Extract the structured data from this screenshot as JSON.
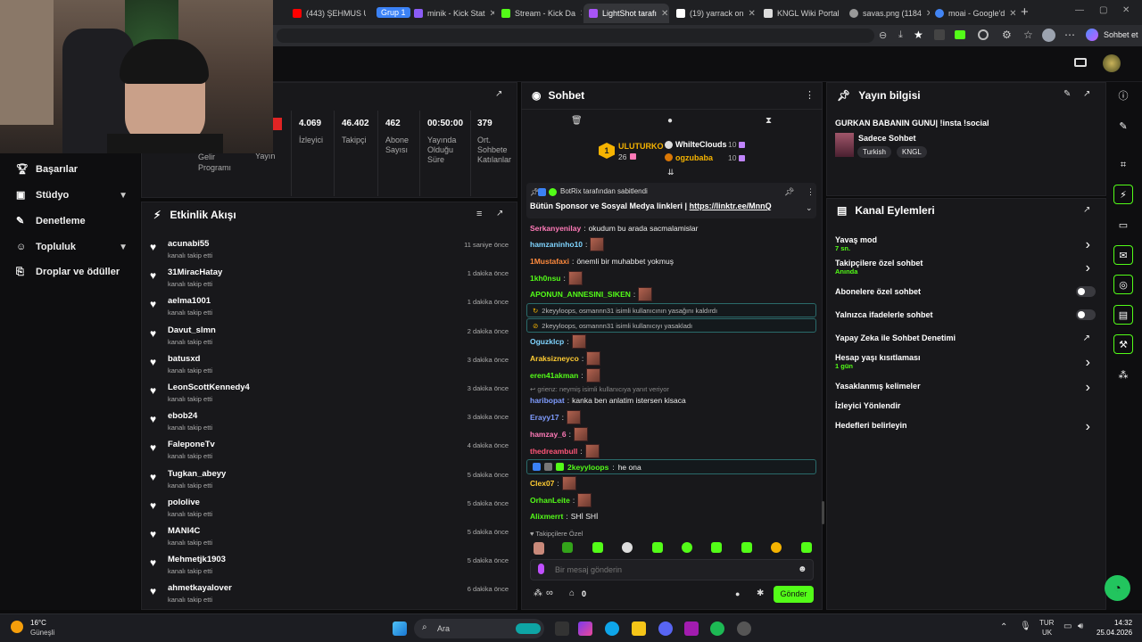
{
  "browser": {
    "tabs": [
      {
        "label": "(443) ŞEHMUS U",
        "color": "#ff0000"
      },
      {
        "label": "minik - Kick Stat",
        "color": "#8b5cf6"
      },
      {
        "label": "Stream - Kick Da",
        "color": "#53fc18"
      },
      {
        "label": "LightShot tarafı",
        "color": "#a855f7"
      },
      {
        "label": "(19) yarrack on",
        "color": "#ffffff"
      },
      {
        "label": "KNGL Wiki Portal",
        "color": "#dddddd"
      },
      {
        "label": "savas.png (1184",
        "color": "#999999"
      },
      {
        "label": "moai - Google'd",
        "color": "#4285f4"
      }
    ],
    "group_label": "Grup 1",
    "new_tab": "+",
    "sohbet_et": "Sohbet et"
  },
  "sidebar": {
    "items": [
      {
        "label": "Başarılar",
        "icon": "trophy-icon"
      },
      {
        "label": "Stüdyo",
        "icon": "studio-icon"
      },
      {
        "label": "Denetleme",
        "icon": "wrench-icon"
      },
      {
        "label": "Topluluk",
        "icon": "community-icon"
      },
      {
        "label": "Droplar ve ödüller",
        "icon": "drops-icon"
      }
    ]
  },
  "stats": {
    "partial": [
      {
        "label": "Gelir Programı"
      },
      {
        "label": "Yayın"
      }
    ],
    "items": [
      {
        "value": "4.069",
        "label": "İzleyici"
      },
      {
        "value": "46.402",
        "label": "Takipçi"
      },
      {
        "value": "462",
        "label": "Abone Sayısı"
      },
      {
        "value": "00:50:00",
        "label": "Yayında Olduğu Süre"
      },
      {
        "value": "379",
        "label": "Ort. Sohbete Katılanlar"
      }
    ]
  },
  "activity": {
    "title": "Etkinlik Akışı",
    "subtitle": "kanalı takip etti",
    "rows": [
      {
        "user": "acunabi55",
        "time": "11 saniye önce"
      },
      {
        "user": "31MiracHatay",
        "time": "1 dakika önce"
      },
      {
        "user": "aelma1001",
        "time": "1 dakika önce"
      },
      {
        "user": "Davut_slmn",
        "time": "2 dakika önce"
      },
      {
        "user": "batusxd",
        "time": "3 dakika önce"
      },
      {
        "user": "LeonScottKennedy4",
        "time": "3 dakika önce"
      },
      {
        "user": "ebob24",
        "time": "3 dakika önce"
      },
      {
        "user": "FaleponeTv",
        "time": "4 dakika önce"
      },
      {
        "user": "Tugkan_abeyy",
        "time": "5 dakika önce"
      },
      {
        "user": "pololive",
        "time": "5 dakika önce"
      },
      {
        "user": "MANI4C",
        "time": "5 dakika önce"
      },
      {
        "user": "Mehmetjk1903",
        "time": "5 dakika önce"
      },
      {
        "user": "ahmetkayalover",
        "time": "6 dakika önce"
      }
    ]
  },
  "chat": {
    "title": "Sohbet",
    "top_gifters": [
      {
        "name": "ULUTURKO",
        "count": "26",
        "rank": "1"
      },
      {
        "name": "WhiIteClouds",
        "count": "10"
      },
      {
        "name": "ogzubaba",
        "count": "10"
      }
    ],
    "pinned_by": "BotRix tarafından sabitlendi",
    "pinned_text": "Bütün Sponsor ve Sosyal Medya linkleri |",
    "pinned_link": "https://linktr.ee/MnnQ",
    "messages": [
      {
        "name": "Serkanyenilay",
        "color": "#ff7ab8",
        "text": "okudum bu arada sacmalamislar",
        "emote": false
      },
      {
        "name": "hamzaninho10",
        "color": "#7fd4ff",
        "text": "",
        "emote": true
      },
      {
        "name": "1Mustafaxi",
        "color": "#ff8a3d",
        "text": "önemli bir muhabbet yokmuş",
        "emote": false
      },
      {
        "name": "1kh0nsu",
        "color": "#53fc18",
        "text": "",
        "emote": true
      },
      {
        "name": "APONUN_ANNESINI_SIKEN",
        "color": "#53fc18",
        "text": "",
        "emote": true
      }
    ],
    "system1": "2keyyloops, osmannn31 isimli kullanıcının yasağını kaldırdı",
    "system2": "2keyyloops, osmannn31 isimli kullanıcıyı yasakladı",
    "messages2": [
      {
        "name": "Oguzklcp",
        "color": "#7fd4ff",
        "text": "",
        "emote": true
      },
      {
        "name": "Araksizneyco",
        "color": "#ffcc33",
        "text": "",
        "emote": true
      },
      {
        "name": "eren41akman",
        "color": "#53fc18",
        "text": "",
        "emote": true
      }
    ],
    "reply_line": "grienz: neymiş isimli kullanıcıya yanıt veriyor",
    "reply_msg": {
      "name": "haribopat",
      "color": "#7f9cff",
      "text": "kanka ben anlatim istersen kisaca"
    },
    "messages3": [
      {
        "name": "Erayy17",
        "color": "#7f9cff",
        "text": "",
        "emote": true
      },
      {
        "name": "hamzay_6",
        "color": "#ff7ab8",
        "text": "",
        "emote": true
      },
      {
        "name": "thedreambull",
        "color": "#ff5577",
        "text": "",
        "emote": true
      }
    ],
    "highlight": {
      "name": "2keyyloops",
      "color": "#53fc18",
      "text": "he ona"
    },
    "messages4": [
      {
        "name": "Clex07",
        "color": "#ffcc33",
        "text": "",
        "emote": true
      },
      {
        "name": "OrhanLeite",
        "color": "#53fc18",
        "text": "",
        "emote": true
      },
      {
        "name": "Alixmerrt",
        "color": "#53fc18",
        "text": "SHİ SHİ",
        "emote": false
      }
    ],
    "followers_only": "Takipçilere Özel",
    "input_placeholder": "Bir mesaj gönderin",
    "infinity": "∞",
    "zero": "0",
    "send": "Gönder"
  },
  "stream_info": {
    "title": "Yayın bilgisi",
    "stream_title": "GURKAN BABANIN GUNU| !insta !social",
    "category": "Sadece Sohbet",
    "tags": [
      "Turkish",
      "KNGL"
    ]
  },
  "channel_actions": {
    "title": "Kanal Eylemleri",
    "items": [
      {
        "label": "Yavaş mod",
        "sub": "7 sn.",
        "control": "arrow"
      },
      {
        "label": "Takipçilere özel sohbet",
        "sub": "Anında",
        "control": "arrow"
      },
      {
        "label": "Abonelere özel sohbet",
        "sub": "",
        "control": "toggle"
      },
      {
        "label": "Yalnızca ifadelerle sohbet",
        "sub": "",
        "control": "toggle"
      },
      {
        "label": "Yapay Zeka ile Sohbet Denetimi",
        "sub": "",
        "control": "external"
      },
      {
        "label": "Hesap yaşı kısıtlaması",
        "sub": "1 gün",
        "control": "arrow"
      },
      {
        "label": "Yasaklanmış kelimeler",
        "sub": "",
        "control": "arrow"
      },
      {
        "label": "İzleyici Yönlendir",
        "sub": "",
        "control": "none"
      },
      {
        "label": "Hedefleri belirleyin",
        "sub": "",
        "control": "arrow"
      }
    ]
  },
  "taskbar": {
    "weather_temp": "16°C",
    "weather_desc": "Güneşli",
    "search": "Ara",
    "lang1": "TUR",
    "lang2": "UK",
    "time": "14:32",
    "date": "25.04.2026"
  }
}
